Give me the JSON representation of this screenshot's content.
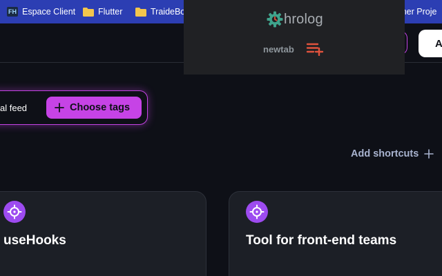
{
  "bookmarks": {
    "items": [
      {
        "icon": "fh-favicon",
        "badge": "FH",
        "label": "Espace Client"
      },
      {
        "icon": "folder-icon",
        "label": "Flutter"
      },
      {
        "icon": "folder-icon",
        "label": "TraideBo"
      },
      {
        "icon": "none",
        "label": "ymer Proje"
      }
    ]
  },
  "header": {
    "white_button_label": "A"
  },
  "popup": {
    "logo_text": "hrolog",
    "page_label": "newtab",
    "logo_icon": "gear-icon",
    "action_icon": "playlist-add-icon"
  },
  "feed": {
    "current_label": "al feed",
    "choose_tags_label": "Choose tags",
    "choose_tags_icon": "plus-icon"
  },
  "shortcuts": {
    "label": "Add shortcuts",
    "icon": "plus-icon"
  },
  "cards": [
    {
      "icon": "crosshair-icon",
      "title": "useHooks"
    },
    {
      "icon": "crosshair-icon",
      "title": "Tool for front-end teams"
    }
  ],
  "colors": {
    "bookmarks_bar": "#2c3eb3",
    "background": "#0e1017",
    "accent": "#c643e6",
    "card_icon": "#9d4bf0",
    "popup_bg": "#202124",
    "logo_green": "#3fa38c",
    "playlist_red": "#e0533d"
  }
}
